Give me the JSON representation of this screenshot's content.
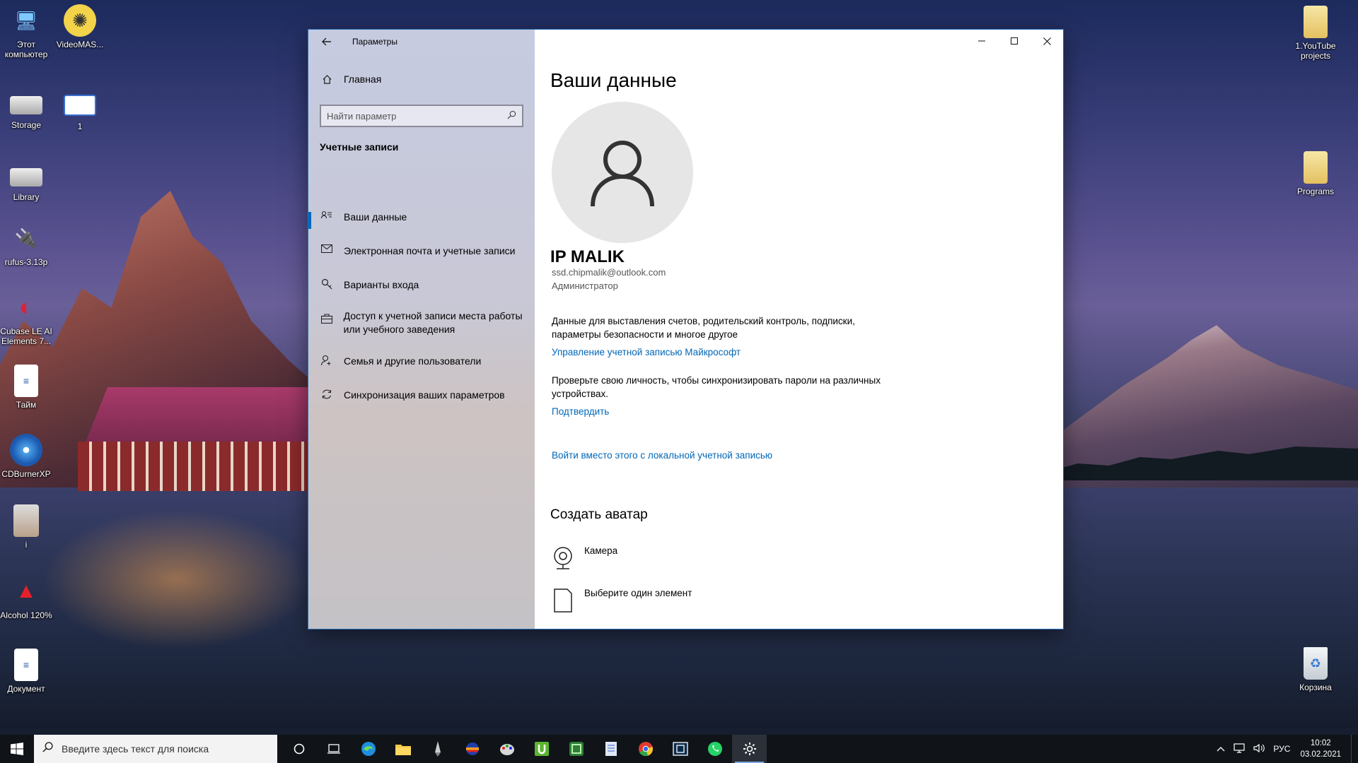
{
  "desktop": {
    "left_icons": [
      {
        "label": "Этот компьютер",
        "icon": "computer-icon"
      },
      {
        "label": "VideoMAS...",
        "icon": "film-reel-icon"
      },
      {
        "label": "Storage",
        "icon": "drive-icon"
      },
      {
        "label": "1",
        "icon": "window-icon"
      },
      {
        "label": "Library",
        "icon": "drive-icon"
      },
      {
        "label": "rufus-3.13p",
        "icon": "usb-icon"
      },
      {
        "label": "Cubase LE AI Elements 7...",
        "icon": "cubase-icon"
      },
      {
        "label": "Тайм",
        "icon": "document-icon"
      },
      {
        "label": "CDBurnerXP",
        "icon": "disc-icon"
      },
      {
        "label": "i",
        "icon": "photo-icon"
      },
      {
        "label": "Alcohol 120%",
        "icon": "alcohol-icon"
      },
      {
        "label": "Документ",
        "icon": "document-icon"
      }
    ],
    "right_icons": [
      {
        "label": "1.YouTube projects",
        "icon": "folder-icon"
      },
      {
        "label": "Programs",
        "icon": "folder-icon"
      },
      {
        "label": "Корзина",
        "icon": "recycle-bin-icon"
      }
    ]
  },
  "window": {
    "title": "Параметры",
    "home_label": "Главная",
    "search_placeholder": "Найти параметр",
    "section_title": "Учетные записи",
    "nav_items": [
      {
        "label": "Ваши данные",
        "icon": "person-card-icon"
      },
      {
        "label": "Электронная почта и учетные записи",
        "icon": "mail-icon"
      },
      {
        "label": "Варианты входа",
        "icon": "key-icon"
      },
      {
        "label": "Доступ к учетной записи места работы или учебного заведения",
        "icon": "briefcase-icon"
      },
      {
        "label": "Семья и другие пользователи",
        "icon": "person-add-icon"
      },
      {
        "label": "Синхронизация ваших параметров",
        "icon": "sync-icon"
      }
    ],
    "active_nav": "Ваши данные"
  },
  "main": {
    "title": "Ваши данные",
    "user_name": "IP MALIK",
    "email": "ssd.chipmalik@outlook.com",
    "role": "Администратор",
    "billing_text": "Данные для выставления счетов, родительский контроль, подписки, параметры безопасности и многое другое",
    "manage_link": "Управление учетной записью Майкрософт",
    "verify_text": "Проверьте свою личность, чтобы синхронизировать пароли на различных устройствах.",
    "verify_link": "Подтвердить",
    "local_account_link": "Войти вместо этого с локальной учетной записью",
    "avatar_section_title": "Создать аватар",
    "avatar_options": [
      {
        "label": "Камера",
        "icon": "webcam-icon"
      },
      {
        "label": "Выберите один элемент",
        "icon": "file-icon"
      }
    ]
  },
  "taskbar": {
    "search_placeholder": "Введите здесь текст для поиска",
    "language": "РУС",
    "time": "10:02",
    "date": "03.02.2021",
    "apps": [
      "cortana-icon",
      "task-view-icon",
      "edge-icon",
      "file-explorer-icon",
      "pen-icon",
      "ball-icon",
      "paint-icon",
      "utorrent-icon",
      "green-app-icon",
      "notepad-icon",
      "chrome-icon",
      "film-icon",
      "whatsapp-icon",
      "settings-icon"
    ]
  },
  "colors": {
    "accent": "#0067c0",
    "link": "#0067b8",
    "taskbar": "#101418"
  }
}
